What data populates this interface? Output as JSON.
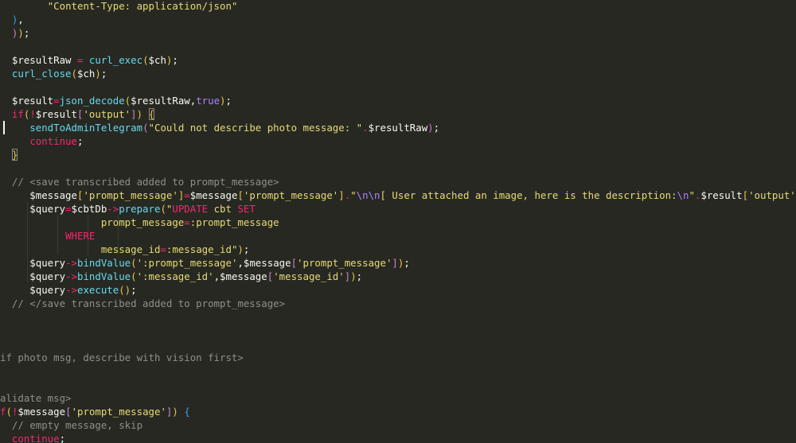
{
  "editor": {
    "theme_colors": {
      "background": "#272822",
      "default": "#f8f8f2",
      "string": "#e6db74",
      "keyword": "#f92672",
      "function": "#66d9ef",
      "constant": "#ae81ff",
      "comment": "#8f8f85"
    },
    "cursor_line": 9,
    "lines": [
      [
        {
          "t": "        ",
          "c": "default"
        },
        {
          "t": "\"Content-Type: application/json\"",
          "c": "str"
        }
      ],
      [
        {
          "t": "  ",
          "c": "default"
        },
        {
          "t": ")",
          "c": "paren3"
        },
        {
          "t": ",",
          "c": "punct"
        }
      ],
      [
        {
          "t": "  ",
          "c": "default"
        },
        {
          "t": ")",
          "c": "paren2"
        },
        {
          "t": ")",
          "c": "paren"
        },
        {
          "t": ";",
          "c": "punct"
        }
      ],
      [],
      [
        {
          "t": "  $resultRaw ",
          "c": "var"
        },
        {
          "t": "=",
          "c": "op"
        },
        {
          "t": " ",
          "c": "default"
        },
        {
          "t": "curl_exec",
          "c": "func"
        },
        {
          "t": "(",
          "c": "paren"
        },
        {
          "t": "$ch",
          "c": "var"
        },
        {
          "t": ")",
          "c": "paren"
        },
        {
          "t": ";",
          "c": "punct"
        }
      ],
      [
        {
          "t": "  ",
          "c": "default"
        },
        {
          "t": "curl_close",
          "c": "func"
        },
        {
          "t": "(",
          "c": "paren"
        },
        {
          "t": "$ch",
          "c": "var"
        },
        {
          "t": ")",
          "c": "paren"
        },
        {
          "t": ";",
          "c": "punct"
        }
      ],
      [],
      [
        {
          "t": "  $result",
          "c": "var"
        },
        {
          "t": "=",
          "c": "op"
        },
        {
          "t": "json_decode",
          "c": "func"
        },
        {
          "t": "(",
          "c": "paren"
        },
        {
          "t": "$resultRaw,",
          "c": "var"
        },
        {
          "t": "true",
          "c": "const"
        },
        {
          "t": ")",
          "c": "paren"
        },
        {
          "t": ";",
          "c": "punct"
        }
      ],
      [
        {
          "t": "  ",
          "c": "default"
        },
        {
          "t": "if",
          "c": "kw"
        },
        {
          "t": "(",
          "c": "paren"
        },
        {
          "t": "!",
          "c": "op"
        },
        {
          "t": "$result",
          "c": "var"
        },
        {
          "t": "[",
          "c": "paren2"
        },
        {
          "t": "'output'",
          "c": "str"
        },
        {
          "t": "]",
          "c": "paren2"
        },
        {
          "t": ")",
          "c": "paren"
        },
        {
          "t": " ",
          "c": "default"
        },
        {
          "t": "{",
          "c": "brace-hl"
        }
      ],
      [
        {
          "t": "     ",
          "c": "default"
        },
        {
          "t": "sendToAdminTelegram",
          "c": "func"
        },
        {
          "t": "(",
          "c": "paren2"
        },
        {
          "t": "\"Could not describe photo message: \"",
          "c": "str"
        },
        {
          "t": ".",
          "c": "op"
        },
        {
          "t": "$resultRaw",
          "c": "var"
        },
        {
          "t": ")",
          "c": "paren2"
        },
        {
          "t": ";",
          "c": "punct"
        }
      ],
      [
        {
          "t": "     ",
          "c": "default"
        },
        {
          "t": "continue",
          "c": "kw"
        },
        {
          "t": ";",
          "c": "punct"
        }
      ],
      [
        {
          "t": "  ",
          "c": "default"
        },
        {
          "t": "}",
          "c": "brace-hl"
        }
      ],
      [],
      [
        {
          "t": "  // <save transcribed added to prompt_message>",
          "c": "comment"
        }
      ],
      [
        {
          "t": "     $message",
          "c": "var"
        },
        {
          "t": "[",
          "c": "paren"
        },
        {
          "t": "'prompt_message'",
          "c": "str"
        },
        {
          "t": "]",
          "c": "paren"
        },
        {
          "t": "=",
          "c": "op"
        },
        {
          "t": "$message",
          "c": "var"
        },
        {
          "t": "[",
          "c": "paren"
        },
        {
          "t": "'prompt_message'",
          "c": "str"
        },
        {
          "t": "]",
          "c": "paren"
        },
        {
          "t": ".",
          "c": "op"
        },
        {
          "t": "\"",
          "c": "str"
        },
        {
          "t": "\\n\\n",
          "c": "esc"
        },
        {
          "t": "[ User attached an image, here is the description:",
          "c": "str"
        },
        {
          "t": "\\n",
          "c": "esc"
        },
        {
          "t": "\"",
          "c": "str"
        },
        {
          "t": ".",
          "c": "op"
        },
        {
          "t": "$result",
          "c": "var"
        },
        {
          "t": "[",
          "c": "paren"
        },
        {
          "t": "'output'",
          "c": "str"
        },
        {
          "t": "]",
          "c": "paren"
        },
        {
          "t": ".",
          "c": "op"
        },
        {
          "t": "\"]\"",
          "c": "str"
        },
        {
          "t": ";",
          "c": "punct"
        }
      ],
      [
        {
          "t": "     $query",
          "c": "var"
        },
        {
          "t": "=",
          "c": "op"
        },
        {
          "t": "$cbtDb",
          "c": "var"
        },
        {
          "t": "->",
          "c": "op"
        },
        {
          "t": "prepare",
          "c": "func"
        },
        {
          "t": "(",
          "c": "paren"
        },
        {
          "t": "\"",
          "c": "str"
        },
        {
          "t": "UPDATE",
          "c": "kw"
        },
        {
          "t": " cbt ",
          "c": "str"
        },
        {
          "t": "SET",
          "c": "kw"
        }
      ],
      [
        {
          "t": "                 prompt_message",
          "c": "str"
        },
        {
          "t": "=",
          "c": "op"
        },
        {
          "t": ":prompt_message",
          "c": "str"
        }
      ],
      [
        {
          "t": "           ",
          "c": "default"
        },
        {
          "t": "WHERE",
          "c": "kw"
        }
      ],
      [
        {
          "t": "                 message_id",
          "c": "str"
        },
        {
          "t": "=",
          "c": "op"
        },
        {
          "t": ":message_id\"",
          "c": "str"
        },
        {
          "t": ")",
          "c": "paren"
        },
        {
          "t": ";",
          "c": "punct"
        }
      ],
      [
        {
          "t": "     $query",
          "c": "var"
        },
        {
          "t": "->",
          "c": "op"
        },
        {
          "t": "bindValue",
          "c": "func"
        },
        {
          "t": "(",
          "c": "paren"
        },
        {
          "t": "':prompt_message'",
          "c": "str"
        },
        {
          "t": ",",
          "c": "punct"
        },
        {
          "t": "$message",
          "c": "var"
        },
        {
          "t": "[",
          "c": "paren2"
        },
        {
          "t": "'prompt_message'",
          "c": "str"
        },
        {
          "t": "]",
          "c": "paren2"
        },
        {
          "t": ")",
          "c": "paren"
        },
        {
          "t": ";",
          "c": "punct"
        }
      ],
      [
        {
          "t": "     $query",
          "c": "var"
        },
        {
          "t": "->",
          "c": "op"
        },
        {
          "t": "bindValue",
          "c": "func"
        },
        {
          "t": "(",
          "c": "paren"
        },
        {
          "t": "':message_id'",
          "c": "str"
        },
        {
          "t": ",",
          "c": "punct"
        },
        {
          "t": "$message",
          "c": "var"
        },
        {
          "t": "[",
          "c": "paren2"
        },
        {
          "t": "'message_id'",
          "c": "str"
        },
        {
          "t": "]",
          "c": "paren2"
        },
        {
          "t": ")",
          "c": "paren"
        },
        {
          "t": ";",
          "c": "punct"
        }
      ],
      [
        {
          "t": "     $query",
          "c": "var"
        },
        {
          "t": "->",
          "c": "op"
        },
        {
          "t": "execute",
          "c": "func"
        },
        {
          "t": "(",
          "c": "paren"
        },
        {
          "t": ")",
          "c": "paren"
        },
        {
          "t": ";",
          "c": "punct"
        }
      ],
      [
        {
          "t": "  // </save transcribed added to prompt_message>",
          "c": "comment"
        }
      ],
      [],
      [],
      [],
      [
        {
          "t": "if photo msg, describe with vision first>",
          "c": "comment"
        }
      ],
      [],
      [],
      [
        {
          "t": "alidate msg>",
          "c": "comment"
        }
      ],
      [
        {
          "t": "f",
          "c": "kw"
        },
        {
          "t": "(",
          "c": "paren"
        },
        {
          "t": "!",
          "c": "op"
        },
        {
          "t": "$message",
          "c": "var"
        },
        {
          "t": "[",
          "c": "paren2"
        },
        {
          "t": "'prompt_message'",
          "c": "str"
        },
        {
          "t": "]",
          "c": "paren2"
        },
        {
          "t": ")",
          "c": "paren"
        },
        {
          "t": " ",
          "c": "default"
        },
        {
          "t": "{",
          "c": "paren3"
        }
      ],
      [
        {
          "t": "  // empty message, skip",
          "c": "comment"
        }
      ],
      [
        {
          "t": "  ",
          "c": "default"
        },
        {
          "t": "continue",
          "c": "kw"
        },
        {
          "t": ";",
          "c": "punct"
        }
      ]
    ]
  }
}
